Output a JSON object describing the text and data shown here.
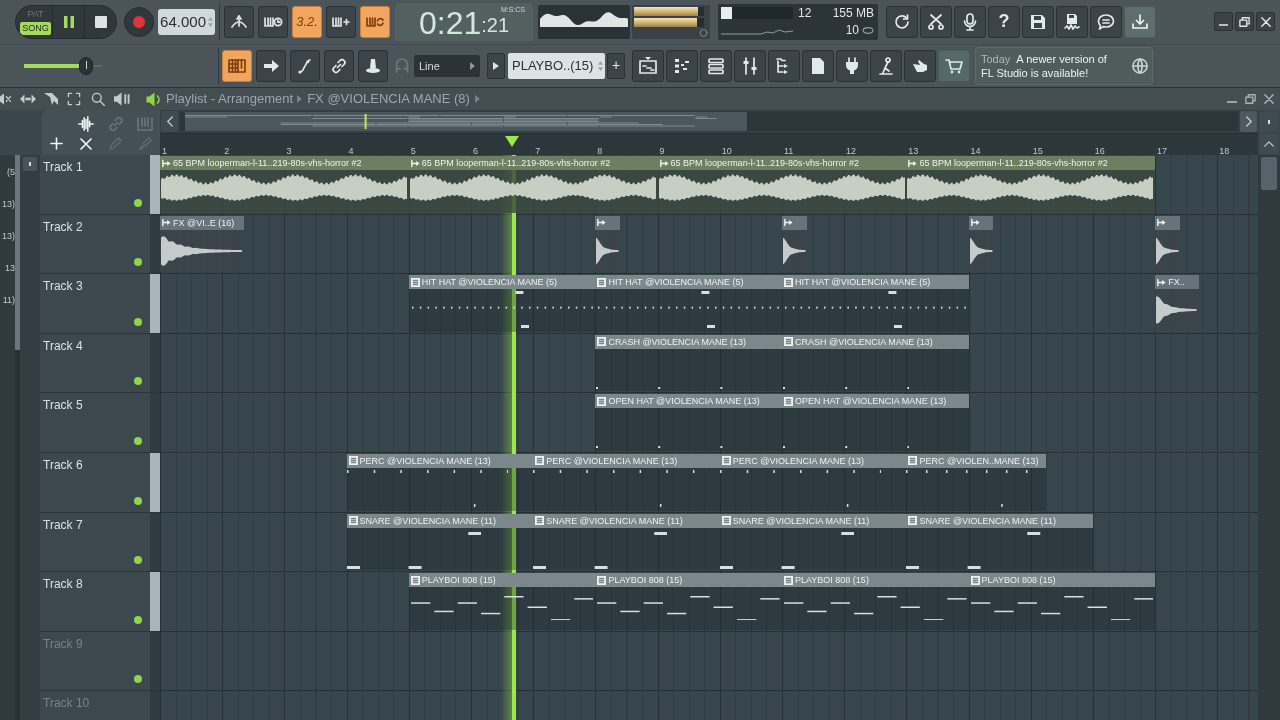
{
  "toolbar": {
    "modes": [
      {
        "label": "PAT",
        "selected": false
      },
      {
        "label": "SONG",
        "selected": true
      }
    ],
    "transport": {
      "playing": true
    },
    "tempo": "64.000",
    "record_options": [
      {
        "kind": "metronome",
        "on": false
      },
      {
        "kind": "wait",
        "on": false
      },
      {
        "kind": "countdown",
        "label": "3.2.",
        "on": true
      },
      {
        "kind": "step",
        "on": false
      },
      {
        "kind": "loop",
        "on": true
      }
    ],
    "time": {
      "main": "0:21",
      "fraction": ":21",
      "unit": "M:S:CS"
    },
    "peak_meter": [
      {
        "level": 0.92
      },
      {
        "level": 0.9
      }
    ],
    "cpu": {
      "level": 0.15,
      "cpu": "12",
      "memory": "155 MB",
      "polyphony": "10"
    },
    "tools": [
      {
        "kind": "refresh",
        "on": false
      },
      {
        "kind": "cut",
        "on": false
      },
      {
        "kind": "mic",
        "on": false
      },
      {
        "kind": "help",
        "label": "?",
        "on": false
      },
      {
        "kind": "save",
        "on": false
      },
      {
        "kind": "export",
        "on": false
      },
      {
        "kind": "chat",
        "on": false
      },
      {
        "kind": "download",
        "on": true
      }
    ],
    "master_volume": {
      "level": 0.8
    },
    "edit_tools": [
      {
        "kind": "piano",
        "on": true
      },
      {
        "kind": "arrow",
        "on": false
      },
      {
        "kind": "curve",
        "on": false
      },
      {
        "kind": "link",
        "on": false
      },
      {
        "kind": "stamp",
        "on": false
      }
    ],
    "snap": "Line",
    "pattern": "PLAYBO..(15)",
    "add_pattern": "+",
    "windows": [
      {
        "kind": "playlist",
        "on": false
      },
      {
        "kind": "pianoroll",
        "on": false
      },
      {
        "kind": "channels",
        "on": false
      },
      {
        "kind": "mixer",
        "on": false
      },
      {
        "kind": "browser",
        "on": false
      },
      {
        "kind": "project",
        "on": false
      },
      {
        "kind": "plugin",
        "on": false
      },
      {
        "kind": "figure",
        "on": false
      },
      {
        "kind": "hand",
        "on": false
      },
      {
        "kind": "cart",
        "on": true
      }
    ],
    "hint": {
      "day": "Today",
      "message": "A newer version of FL Studio is available!"
    }
  },
  "playlist": {
    "title": "Playlist - Arrangement",
    "pattern": "FX @VIOLENCIA MANE (8)",
    "picker": [
      "(5",
      "13)",
      "13)",
      "13",
      "11)"
    ],
    "ruler": [
      "1",
      "2",
      "3",
      "4",
      "5",
      "6",
      "7",
      "8",
      "9",
      "10",
      "11",
      "12",
      "13",
      "14",
      "15",
      "16",
      "17",
      "18"
    ],
    "tracks": [
      {
        "name": "Track 1",
        "empty": false,
        "enabled": true,
        "marked": true,
        "clips": [
          {
            "kind": "audio",
            "label": "65 BPM looperman-l-11..219-80s-vhs-horror #2",
            "color": "#6c7f61"
          },
          {
            "kind": "audio",
            "label": "65 BPM looperman-l-11..219-80s-vhs-horror #2",
            "color": "#6c7f61"
          },
          {
            "kind": "audio",
            "label": "65 BPM looperman-l-11..219-80s-vhs-horror #2",
            "color": "#6c7f61"
          },
          {
            "kind": "audio",
            "label": "65 BPM looperman-l-11..219-80s-vhs-horror #2",
            "color": "#6c7f61"
          }
        ]
      },
      {
        "name": "Track 2",
        "empty": false,
        "enabled": true,
        "marked": false,
        "clips": [
          {
            "kind": "audio",
            "label": "FX @VI..E (16)",
            "color": "#66737a"
          },
          {
            "kind": "audio",
            "color": "#66737a"
          },
          {
            "kind": "audio",
            "color": "#66737a"
          },
          {
            "kind": "audio",
            "color": "#66737a"
          },
          {
            "kind": "audio",
            "color": "#66737a"
          }
        ]
      },
      {
        "name": "Track 3",
        "empty": false,
        "enabled": true,
        "marked": true,
        "clips": [
          {
            "kind": "pattern",
            "label": "HIT HAT @VIOLENCIA MANE (5)",
            "color": "#7c878c"
          },
          {
            "kind": "pattern",
            "label": "HIT HAT @VIOLENCIA MANE (5)",
            "color": "#7c878c"
          },
          {
            "kind": "pattern",
            "label": "HIT HAT @VIOLENCIA MANE (5)",
            "color": "#7c878c"
          },
          {
            "kind": "audio",
            "label": "FX..",
            "color": "#66737a"
          }
        ]
      },
      {
        "name": "Track 4",
        "empty": false,
        "enabled": true,
        "marked": false,
        "clips": [
          {
            "kind": "pattern",
            "label": "CRASH @VIOLENCIA MANE (13)",
            "color": "#7c878c"
          },
          {
            "kind": "pattern",
            "label": "CRASH @VIOLENCIA MANE (13)",
            "color": "#7c878c"
          }
        ]
      },
      {
        "name": "Track 5",
        "empty": false,
        "enabled": true,
        "marked": false,
        "clips": [
          {
            "kind": "pattern",
            "label": "OPEN HAT @VIOLENCIA MANE (13)",
            "color": "#7c878c"
          },
          {
            "kind": "pattern",
            "label": "OPEN HAT @VIOLENCIA MANE (13)",
            "color": "#7c878c"
          }
        ]
      },
      {
        "name": "Track 6",
        "empty": false,
        "enabled": true,
        "marked": true,
        "clips": [
          {
            "kind": "pattern",
            "label": "PERC @VIOLENCIA MANE (13)",
            "color": "#7c878c"
          },
          {
            "kind": "pattern",
            "label": "PERC @VIOLENCIA MANE (13)",
            "color": "#7c878c"
          },
          {
            "kind": "pattern",
            "label": "PERC @VIOLENCIA MANE (13)",
            "color": "#7c878c"
          },
          {
            "kind": "pattern",
            "label": "PERC @VIOLEN..MANE (13)",
            "color": "#7c878c"
          }
        ]
      },
      {
        "name": "Track 7",
        "empty": false,
        "enabled": true,
        "marked": false,
        "clips": [
          {
            "kind": "pattern",
            "label": "SNARE @VIOLENCIA MANE (11)",
            "color": "#7c878c"
          },
          {
            "kind": "pattern",
            "label": "SNARE @VIOLENCIA MANE (11)",
            "color": "#7c878c"
          },
          {
            "kind": "pattern",
            "label": "SNARE @VIOLENCIA MANE (11)",
            "color": "#7c878c"
          },
          {
            "kind": "pattern",
            "label": "SNARE @VIOLENCIA MANE (11)",
            "color": "#7c878c"
          }
        ]
      },
      {
        "name": "Track 8",
        "empty": false,
        "enabled": true,
        "marked": true,
        "clips": [
          {
            "kind": "pattern",
            "label": "PLAYBOI 808 (15)",
            "color": "#7c878c"
          },
          {
            "kind": "pattern",
            "label": "PLAYBOI 808 (15)",
            "color": "#7c878c"
          },
          {
            "kind": "pattern",
            "label": "PLAYBOI 808 (15)",
            "color": "#7c878c"
          },
          {
            "kind": "pattern",
            "label": "PLAYBOI 808 (15)",
            "color": "#7c878c"
          }
        ]
      },
      {
        "name": "Track 9",
        "empty": true,
        "enabled": true,
        "marked": false
      },
      {
        "name": "Track 10",
        "empty": true,
        "marked": false
      }
    ]
  }
}
